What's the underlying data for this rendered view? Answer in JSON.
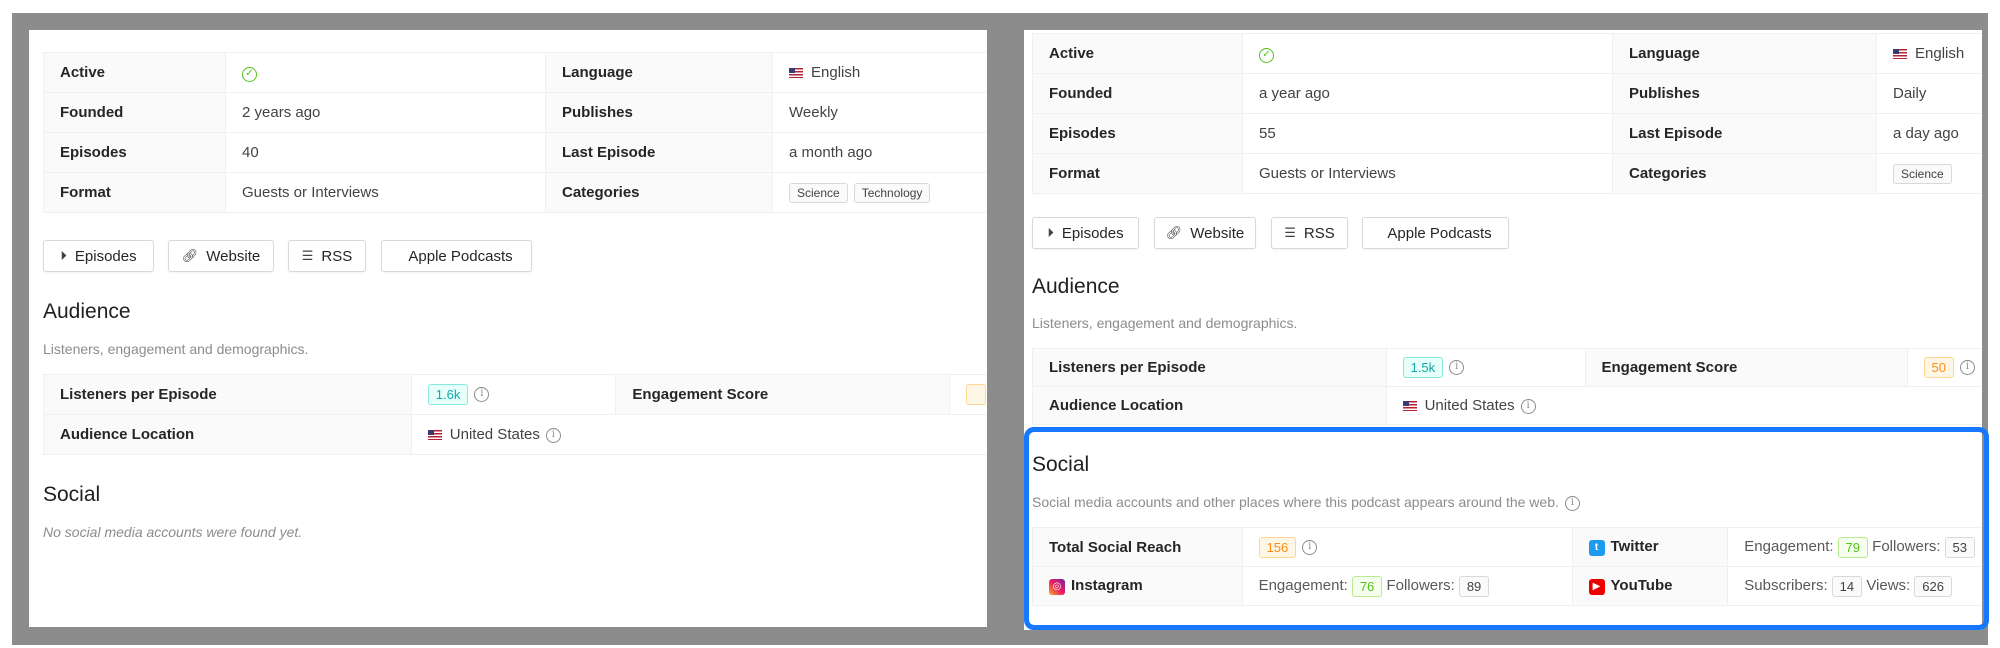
{
  "left": {
    "details": [
      {
        "label": "Active",
        "value": "",
        "label2": "Language",
        "value2": "English"
      },
      {
        "label": "Founded",
        "value": "2 years ago",
        "label2": "Publishes",
        "value2": "Weekly"
      },
      {
        "label": "Episodes",
        "value": "40",
        "label2": "Last Episode",
        "value2": "a month ago"
      },
      {
        "label": "Format",
        "value": "Guests or Interviews",
        "label2": "Categories",
        "tags": [
          "Science",
          "Technology"
        ]
      }
    ],
    "buttons": [
      "Episodes",
      "Website",
      "RSS",
      "Apple Podcasts"
    ],
    "audience": {
      "title": "Audience",
      "subtitle": "Listeners, engagement and demographics.",
      "listeners_label": "Listeners per Episode",
      "listeners": "1.6k",
      "engagement_label": "Engagement Score",
      "location_label": "Audience Location",
      "location": "United States"
    },
    "social": {
      "title": "Social",
      "empty": "No social media accounts were found yet."
    }
  },
  "right": {
    "details": [
      {
        "label": "Active",
        "value": "",
        "label2": "Language",
        "value2": "English"
      },
      {
        "label": "Founded",
        "value": "a year ago",
        "label2": "Publishes",
        "value2": "Daily"
      },
      {
        "label": "Episodes",
        "value": "55",
        "label2": "Last Episode",
        "value2": "a day ago"
      },
      {
        "label": "Format",
        "value": "Guests or Interviews",
        "label2": "Categories",
        "tags": [
          "Science"
        ]
      }
    ],
    "buttons": [
      "Episodes",
      "Website",
      "RSS",
      "Apple Podcasts"
    ],
    "audience": {
      "title": "Audience",
      "subtitle": "Listeners, engagement and demographics.",
      "listeners_label": "Listeners per Episode",
      "listeners": "1.5k",
      "engagement_label": "Engagement Score",
      "engagement": "50",
      "location_label": "Audience Location",
      "location": "United States"
    },
    "social": {
      "title": "Social",
      "subtitle": "Social media accounts and other places where this podcast appears around the web.",
      "reach_label": "Total Social Reach",
      "reach": "156",
      "twitter": {
        "name": "Twitter",
        "k1": "Engagement:",
        "v1": "79",
        "k2": "Followers:",
        "v2": "53"
      },
      "instagram": {
        "name": "Instagram",
        "k1": "Engagement:",
        "v1": "76",
        "k2": "Followers:",
        "v2": "89"
      },
      "youtube": {
        "name": "YouTube",
        "k1": "Subscribers:",
        "v1": "14",
        "k2": "Views:",
        "v2": "626"
      }
    }
  },
  "colors": {
    "highlight": "#1677ff",
    "active": "#52c41a"
  }
}
